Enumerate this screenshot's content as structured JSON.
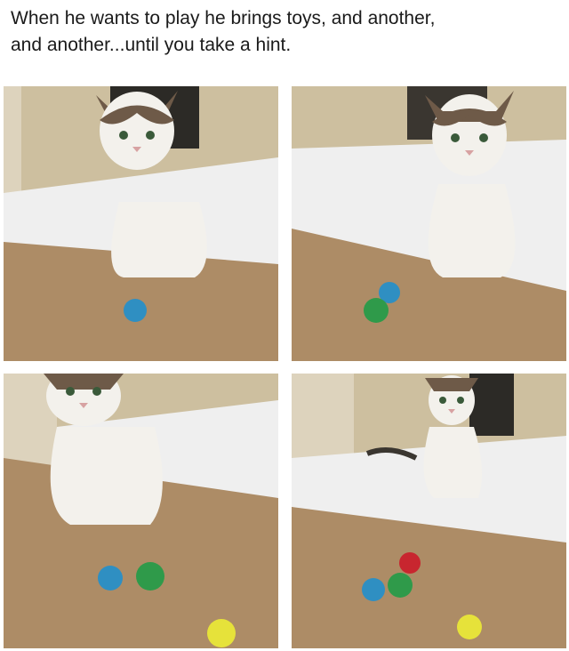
{
  "meme": {
    "caption_line1": "When he wants to play he brings toys, and another,",
    "caption_line2": "and another...until you take a hint."
  },
  "colors": {
    "wall": "#c9c0a3",
    "sheet": "#f1f1f1",
    "blanket": "#b08f6a",
    "cat_white": "#f3f1ec",
    "cat_tabby": "#6e5a48",
    "toy_blue": "#2f8fc2",
    "toy_green": "#2f9a4a",
    "toy_yellow": "#e6e23a",
    "toy_red": "#c8262f"
  },
  "panels": [
    {
      "name": "panel-1",
      "toys": [
        "blue"
      ]
    },
    {
      "name": "panel-2",
      "toys": [
        "blue",
        "green"
      ]
    },
    {
      "name": "panel-3",
      "toys": [
        "blue",
        "green",
        "yellow"
      ]
    },
    {
      "name": "panel-4",
      "toys": [
        "blue",
        "green",
        "red",
        "yellow"
      ]
    }
  ]
}
